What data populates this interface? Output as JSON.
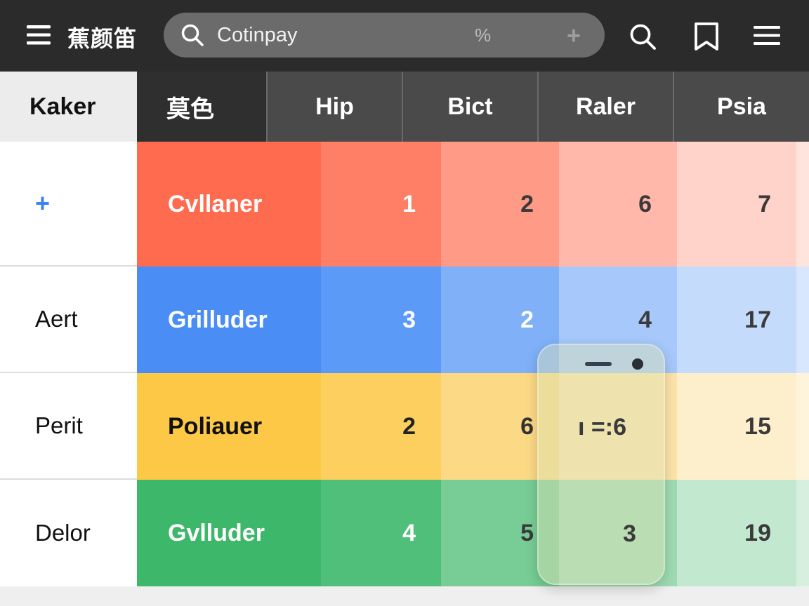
{
  "app": {
    "title": "蕉颜笛"
  },
  "search": {
    "value": "Cotinpay",
    "suffix": "%",
    "add_label": "+"
  },
  "table": {
    "corner": "Kaker",
    "columns": [
      "莫色",
      "Hip",
      "Bict",
      "Raler",
      "Psia"
    ],
    "rows": [
      {
        "label": "+",
        "name": "Cvllaner",
        "values": [
          "1",
          "2",
          "6",
          "7"
        ]
      },
      {
        "label": "Aert",
        "name": "Grilluder",
        "values": [
          "3",
          "2",
          "4",
          "17"
        ]
      },
      {
        "label": "Perit",
        "name": "Poliauer",
        "values": [
          "2",
          "6",
          "",
          "15"
        ]
      },
      {
        "label": "Delor",
        "name": "Gvlluder",
        "values": [
          "4",
          "5",
          "",
          "19"
        ]
      }
    ]
  },
  "phone_overlay": {
    "screen_text": "ı =:6",
    "bottom_text": "3"
  },
  "colors": {
    "topbar": "#2b2b2b",
    "header": "#4a4a4a",
    "header_first": "#2f2f2f",
    "red": "#ff6b4f",
    "blue": "#4a8ef5",
    "yellow": "#fcc845",
    "green": "#3db76a",
    "plus_blue": "#3b82f6"
  }
}
